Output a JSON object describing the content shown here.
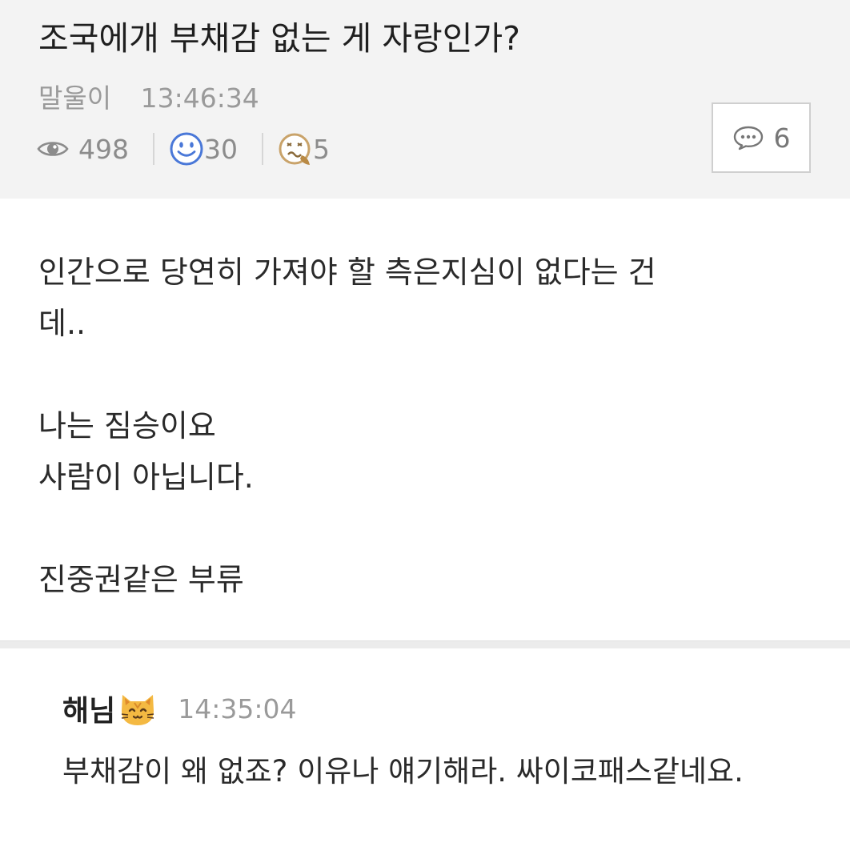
{
  "post": {
    "title": "조국에개 부채감 없는 게 자랑인가?",
    "author": "말울이",
    "time": "13:46:34",
    "views": "498",
    "likes": "30",
    "dislikes": "5",
    "comment_count": "6",
    "body_lines": [
      "인간으로 당연히 가져야 할 측은지심이 없다는 건",
      "데..",
      "",
      "나는 짐승이요",
      "사람이 아닙니다.",
      "",
      "진중권같은 부류"
    ]
  },
  "comment": {
    "author": "해님",
    "time": "14:35:04",
    "text": "부채감이 왜 없죠? 이유나 얘기해라. 싸이코패스같네요."
  },
  "icons": {
    "views": "eye-icon",
    "likes": "smiley-icon",
    "dislikes": "disgusted-face-icon",
    "comments": "speech-bubble-icon",
    "commenter_badge": "cat-face-icon"
  },
  "colors": {
    "header_bg": "#f3f3f3",
    "like_blue": "#4a78d8",
    "dislike_tan": "#c9a36a",
    "cat_orange": "#f4b942"
  }
}
